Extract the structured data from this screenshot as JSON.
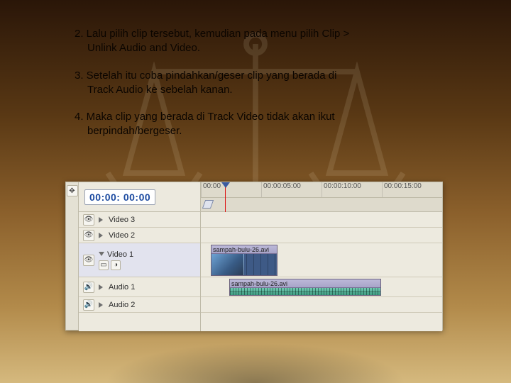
{
  "instructions": {
    "item2": "2. Lalu pilih clip tersebut, kemudian pada menu pilih Clip >",
    "item2b": "Unlink Audio and Video.",
    "item3": "3. Setelah itu coba pindahkan/geser clip yang berada di",
    "item3b": "Track Audio ke sebelah kanan.",
    "item4": "4. Maka clip yang berada di Track Video tidak akan ikut",
    "item4b": "berpindah/bergeser."
  },
  "timeline": {
    "timecode": "00:00: 00:00",
    "ruler": [
      "00:00",
      "00:00:05:00",
      "00:00:10:00",
      "00:00:15:00"
    ],
    "tracks": {
      "video3": "Video 3",
      "video2": "Video 2",
      "video1": "Video 1",
      "audio1": "Audio 1",
      "audio2": "Audio 2"
    },
    "clips": {
      "video_name": "sampah-bulu-26.avi",
      "audio_name": "sampah-bulu-26.avi"
    }
  }
}
